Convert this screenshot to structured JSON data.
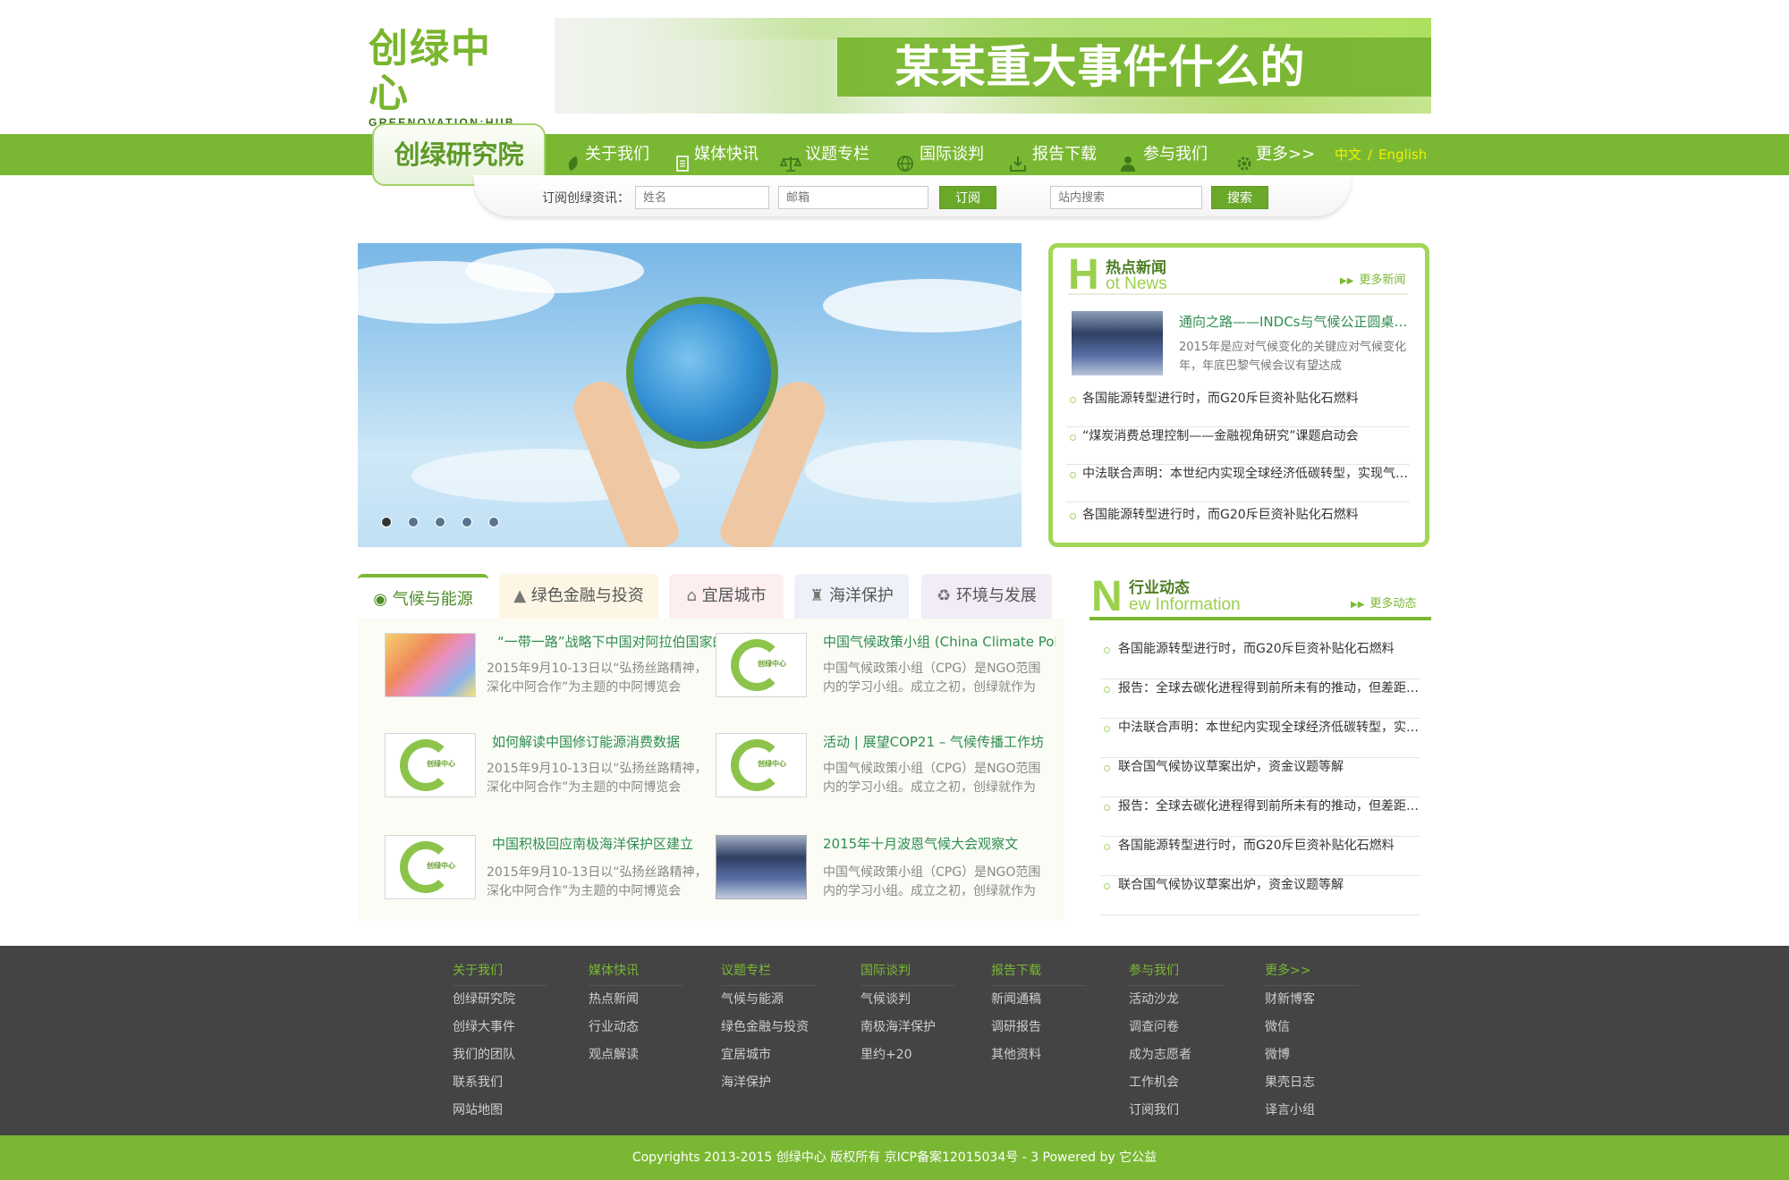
{
  "header": {
    "logo_cn": "创绿中心",
    "logo_en": "GREENOVATION:HUB",
    "banner_title": "某某重大事件什么的"
  },
  "nav": {
    "brand": "创绿研究院",
    "items": [
      {
        "label": "关于我们",
        "icon": "leaf-icon"
      },
      {
        "label": "媒体快讯",
        "icon": "document-icon"
      },
      {
        "label": "议题专栏",
        "icon": "scales-icon"
      },
      {
        "label": "国际谈判",
        "icon": "globe-icon"
      },
      {
        "label": "报告下载",
        "icon": "download-icon"
      },
      {
        "label": "参与我们",
        "icon": "user-icon"
      },
      {
        "label": "更多>>",
        "icon": "gear-icon"
      }
    ],
    "lang_cn": "中文",
    "lang_sep": "/",
    "lang_en": "English"
  },
  "subscribe": {
    "label": "订阅创绿资讯：",
    "name_placeholder": "姓名",
    "email_placeholder": "邮箱",
    "subscribe_button": "订阅",
    "search_placeholder": "站内搜索",
    "search_button": "搜索"
  },
  "slider": {
    "dots": 5,
    "active_index": 0
  },
  "hot_news": {
    "big_letter": "H",
    "title_cn": "热点新闻",
    "title_en": "ot News",
    "more": "更多新闻",
    "featured_title": "通向之路——INDCs与气候公正圆桌会议",
    "featured_desc": "2015年是应对气候变化的关键应对气候变化年，年底巴黎气候会议有望达成",
    "items": [
      "各国能源转型进行时，而G20斥巨资补贴化石燃料",
      "“煤炭消费总理控制——金融视角研究”课题启动会",
      "中法联合声明：本世纪内实现全球经济低碳转型，实现气候目标",
      "各国能源转型进行时，而G20斥巨资补贴化石燃料"
    ]
  },
  "tabs": [
    {
      "label": "气候与能源",
      "icon": "eye-icon",
      "color": "#ffffff"
    },
    {
      "label": "绿色金融与投资",
      "icon": "tree-icon",
      "color": "#fdf6e4"
    },
    {
      "label": "宜居城市",
      "icon": "house-icon",
      "color": "#fdeef0"
    },
    {
      "label": "海洋保护",
      "icon": "lighthouse-icon",
      "color": "#eef1f8"
    },
    {
      "label": "环境与发展",
      "icon": "recycle-icon",
      "color": "#f2ecf7"
    }
  ],
  "articles": [
    {
      "title": "“一带一路”战略下中国对阿拉伯国家的投资",
      "desc": "2015年9月10-13日以“弘扬丝路精神，深化中阿合作”为主题的中阿博览会",
      "img": "map"
    },
    {
      "title": "中国气候政策小组 (China Climate Policy Group)",
      "desc": "中国气候政策小组（CPG）是NGO范围内的学习小组。成立之初，创绿就作为",
      "img": "logo"
    },
    {
      "title": "如何解读中国修订能源消费数据",
      "desc": "2015年9月10-13日以“弘扬丝路精神，深化中阿合作”为主题的中阿博览会",
      "img": "logo"
    },
    {
      "title": "活动 | 展望COP21 – 气候传播工作坊",
      "desc": "中国气候政策小组（CPG）是NGO范围内的学习小组。成立之初，创绿就作为",
      "img": "logo"
    },
    {
      "title": "中国积极回应南极海洋保护区建立",
      "desc": "2015年9月10-13日以“弘扬丝路精神，深化中阿合作”为主题的中阿博览会",
      "img": "logo"
    },
    {
      "title": "2015年十月波恩气候大会观察文",
      "desc": "中国气候政策小组（CPG）是NGO范围内的学习小组。成立之初，创绿就作为",
      "img": "photo"
    }
  ],
  "industry": {
    "big_letter": "N",
    "title_cn": "行业动态",
    "title_en": "ew Information",
    "more": "更多动态",
    "items": [
      "各国能源转型进行时，而G20斥巨资补贴化石燃料",
      "报告：全球去碳化进程得到前所未有的推动，但差距仍存",
      "中法联合声明：本世纪内实现全球经济低碳转型，实现气候目标",
      "联合国气候协议草案出炉，资金议题等解",
      "报告：全球去碳化进程得到前所未有的推动，但差距仍存",
      "各国能源转型进行时，而G20斥巨资补贴化石燃料",
      "联合国气候协议草案出炉，资金议题等解"
    ]
  },
  "footer": {
    "columns": [
      {
        "head": "关于我们",
        "links": [
          "创绿研究院",
          "创绿大事件",
          "我们的团队",
          "联系我们",
          "网站地图"
        ]
      },
      {
        "head": "媒体快讯",
        "links": [
          "热点新闻",
          "行业动态",
          "观点解读"
        ]
      },
      {
        "head": "议题专栏",
        "links": [
          "气候与能源",
          "绿色金融与投资",
          "宜居城市",
          "海洋保护"
        ]
      },
      {
        "head": "国际谈判",
        "links": [
          "气候谈判",
          "南极海洋保护",
          "里约+20"
        ]
      },
      {
        "head": "报告下载",
        "links": [
          "新闻通稿",
          "调研报告",
          "其他资料"
        ]
      },
      {
        "head": "参与我们",
        "links": [
          "活动沙龙",
          "调查问卷",
          "成为志愿者",
          "工作机会",
          "订阅我们"
        ]
      },
      {
        "head": "更多>>",
        "links": [
          "财新博客",
          "微信",
          "微博",
          "果壳日志",
          "译言小组"
        ]
      }
    ],
    "copyright": "Copyrights 2013-2015  创绿中心 版权所有  京ICP备案12015034号 - 3  Powered by 它公益"
  },
  "colors": {
    "brand_green": "#7ab833",
    "light_green": "#a3d657",
    "text_green": "#2f8d51",
    "footer_bg": "#444444",
    "lang_yellow": "#f4f000"
  }
}
